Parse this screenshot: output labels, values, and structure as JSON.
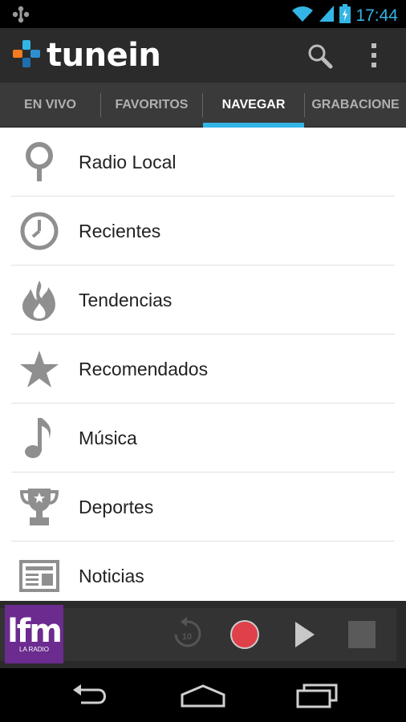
{
  "status_bar": {
    "time": "17:44"
  },
  "app": {
    "brand_name": "tunein"
  },
  "tabs": [
    {
      "label": "EN VIVO",
      "active": false
    },
    {
      "label": "FAVORITOS",
      "active": false
    },
    {
      "label": "NAVEGAR",
      "active": true
    },
    {
      "label": "GRABACIONE",
      "active": false
    }
  ],
  "menu": {
    "items": [
      {
        "label": "Radio Local",
        "icon": "location-pin-icon"
      },
      {
        "label": "Recientes",
        "icon": "clock-icon"
      },
      {
        "label": "Tendencias",
        "icon": "flame-icon"
      },
      {
        "label": "Recomendados",
        "icon": "star-icon"
      },
      {
        "label": "Música",
        "icon": "music-note-icon"
      },
      {
        "label": "Deportes",
        "icon": "trophy-icon"
      },
      {
        "label": "Noticias",
        "icon": "newspaper-icon"
      }
    ]
  },
  "player": {
    "station_logo_text": "lfm",
    "station_logo_sub": "LA RADIO",
    "rewind_seconds": "10"
  },
  "colors": {
    "accent": "#33b5e5",
    "record": "#e0404a",
    "station_logo_bg": "#6b2b8f",
    "icon_gray": "#8f8f8f"
  }
}
